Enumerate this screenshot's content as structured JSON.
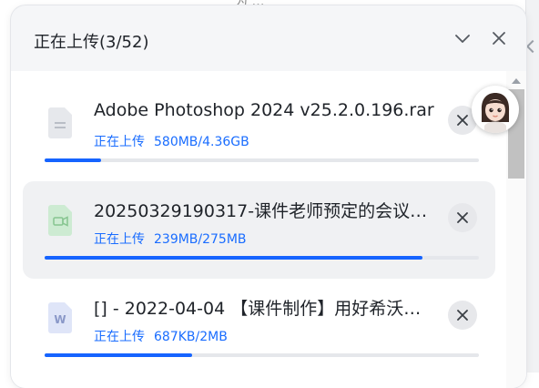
{
  "background_text": "为 …",
  "panel": {
    "title": "正在上传(3/52)",
    "collapse_icon": "chevron-down-icon",
    "close_icon": "close-icon"
  },
  "uploads": [
    {
      "file_name": "Adobe Photoshop 2024 v25.2.0.196.rar",
      "file_icon": "archive-file-icon",
      "status": "正在上传",
      "size": "580MB/4.36GB",
      "progress": 0.13,
      "highlighted": false
    },
    {
      "file_name": "20250329190317-课件老师预定的会议…",
      "file_icon": "video-file-icon",
      "status": "正在上传",
      "size": "239MB/275MB",
      "progress": 0.87,
      "highlighted": true
    },
    {
      "file_name": "[] - 2022-04-04 【课件制作】用好希沃…",
      "file_icon": "word-file-icon",
      "status": "正在上传",
      "size": "687KB/2MB",
      "progress": 0.34,
      "highlighted": false
    }
  ],
  "colors": {
    "accent": "#1664ff",
    "status_text": "#1a6dff",
    "track": "#e5e7eb",
    "panel_bg": "#f5f6f8"
  }
}
